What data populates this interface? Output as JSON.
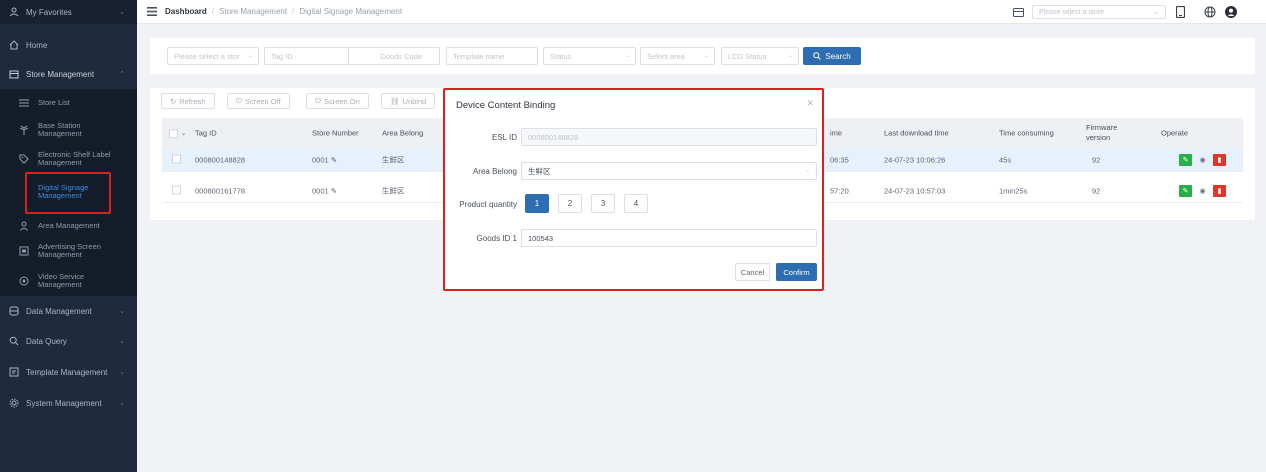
{
  "sidebar": {
    "favorites": "My Favorites",
    "home": "Home",
    "store_management": "Store Management",
    "sub_items": [
      {
        "label": "Store List"
      },
      {
        "label": "Base Station\nManagement"
      },
      {
        "label": "Electronic Shelf Label\nManagement"
      },
      {
        "label": "Digital Signage\nManagement"
      },
      {
        "label": "Area Management"
      },
      {
        "label": "Advertising Screen\nManagement"
      },
      {
        "label": "Video Service\nManagement"
      }
    ],
    "data_management": "Data Management",
    "data_query": "Data Query",
    "template_management": "Template Management",
    "system_management": "System Management"
  },
  "header": {
    "breadcrumb": [
      "Dashboard",
      "Store Management",
      "Digital Signage Management"
    ],
    "store_placeholder": "Please select a store"
  },
  "search": {
    "store_placeholder": "Please select a stor",
    "tag_id_placeholder": "Tag ID",
    "goods_code_placeholder": "Goods Code",
    "template_placeholder": "Template name",
    "status_placeholder": "Status",
    "area_placeholder": "Select area",
    "lcd_placeholder": "LCD Status",
    "search_label": "Search"
  },
  "toolbar": {
    "refresh": "Refresh",
    "screen_off": "Screen Off",
    "screen_on": "Screen On",
    "unbind": "Unbind"
  },
  "table": {
    "headers": {
      "tag_id": "Tag ID",
      "store_number": "Store Number",
      "area_belong": "Area Belong",
      "time_partial": "ime",
      "last_download": "Last download time",
      "time_consuming": "Time consuming",
      "firmware": "Firmware\nversion",
      "operate": "Operate"
    },
    "rows": [
      {
        "tag_id": "000800148828",
        "store_number": "0001",
        "area": "生鲜区",
        "time_partial": "06:35",
        "last_download": "24-07-23 10:06:26",
        "time_consuming": "45s",
        "firmware": "92"
      },
      {
        "tag_id": "000800161778",
        "store_number": "0001",
        "area": "生鲜区",
        "time_partial": "57:20",
        "last_download": "24-07-23 10:57:03",
        "time_consuming": "1min25s",
        "firmware": "92"
      }
    ]
  },
  "modal": {
    "title": "Device Content Binding",
    "esl_label": "ESL ID",
    "esl_value": "000800148828",
    "area_label": "Area Belong",
    "area_value": "生鲜区",
    "qty_label": "Product quantity",
    "qty_options": [
      "1",
      "2",
      "3",
      "4"
    ],
    "qty_selected": "1",
    "goods_label": "Goods ID 1",
    "goods_value": "100543",
    "cancel": "Cancel",
    "confirm": "Confirm"
  },
  "colors": {
    "sidebar_bg": "#1f2a3c",
    "primary": "#2d6db2",
    "highlight_box": "#e02020",
    "active_text": "#3a8ee6",
    "edit_green": "#27b04a",
    "delete_red": "#e0352b"
  }
}
